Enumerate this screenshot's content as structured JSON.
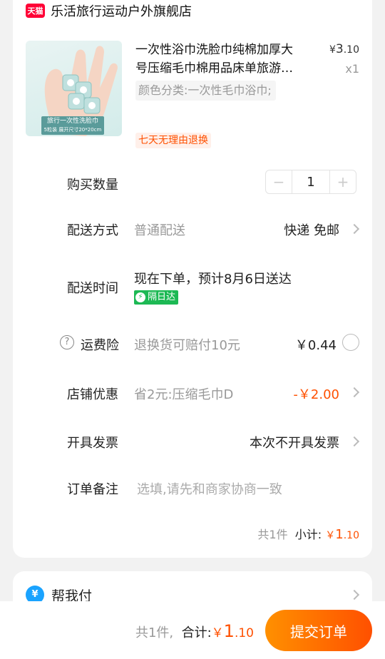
{
  "shop": {
    "badge": "天猫",
    "name": "乐活旅行运动户外旗舰店"
  },
  "product": {
    "title_line1": "一次性浴巾洗脸巾纯棉加厚大",
    "title_line2": "号压缩毛巾棉用品床单旅游…",
    "price_symbol": "¥",
    "price_int": "3",
    "price_dec": ".10",
    "qty": "x1",
    "sku": "颜色分类:一次性毛巾浴巾;",
    "service_tag": "七天无理由退换",
    "thumb_banner_line1": "旅行一次性洗脸巾",
    "thumb_banner_line2": "5粒装 展开尺寸20*20cm"
  },
  "quantity": {
    "label": "购买数量",
    "minus": "−",
    "value": "1",
    "plus": "+"
  },
  "delivery_method": {
    "label": "配送方式",
    "value": "普通配送",
    "right": "快递 免邮"
  },
  "delivery_time": {
    "label": "配送时间",
    "value": "现在下单，预计8月6日送达",
    "badge": "隔日达"
  },
  "insurance": {
    "icon": "?",
    "label": "运费险",
    "value": "退换货可赔付10元",
    "price": "￥0.44"
  },
  "discount": {
    "label": "店铺优惠",
    "value": "省2元:压缩毛巾D",
    "amount": "-￥2.00"
  },
  "invoice": {
    "label": "开具发票",
    "value": "本次不开具发票"
  },
  "note": {
    "label": "订单备注",
    "placeholder": "选填,请先和商家协商一致"
  },
  "subtotal": {
    "count": "共1件",
    "label": "小计:",
    "symbol": "￥",
    "int": "1",
    "dec": ".10"
  },
  "help_pay": {
    "icon": "¥",
    "label": "帮我付"
  },
  "footer": {
    "count": "共1件,",
    "label": "合计:",
    "symbol": "￥",
    "int": "1",
    "dec": ".10",
    "submit": "提交订单"
  },
  "colors": {
    "accent": "#ff5000",
    "tmall_red": "#ff0036",
    "green": "#1db954",
    "blue": "#1aa3ff"
  }
}
